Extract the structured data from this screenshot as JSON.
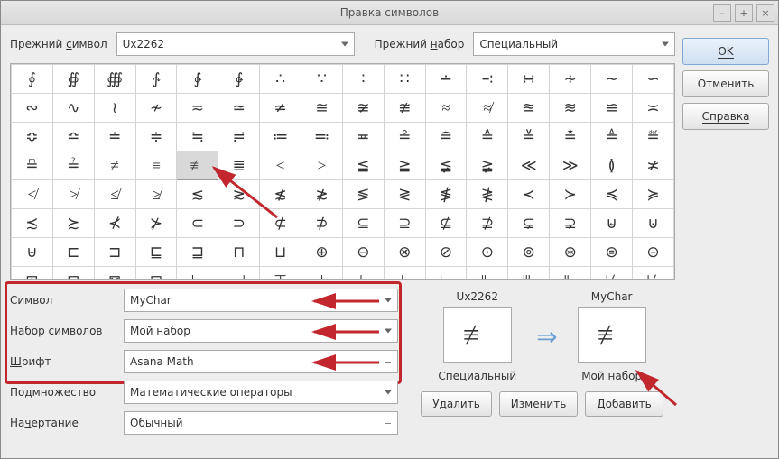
{
  "title": "Правка символов",
  "window_buttons": {
    "min": "–",
    "max": "+",
    "close": "×"
  },
  "side_buttons": {
    "ok": "OK",
    "cancel": "Отменить",
    "help": "Справка"
  },
  "top": {
    "old_symbol_label_pre": "Прежний ",
    "old_symbol_label_u": "с",
    "old_symbol_label_post": "имвол",
    "old_symbol_value": "Ux2262",
    "old_set_label_pre": "Прежний ",
    "old_set_label_u": "н",
    "old_set_label_post": "абор",
    "old_set_value": "Специальный"
  },
  "selected_char": "≢",
  "form": {
    "symbol_label": "Символ",
    "symbol_value": "MyChar",
    "set_label": "Набор символов",
    "set_value": "Мой набор",
    "font_label_u": "Ш",
    "font_label_post": "рифт",
    "font_value": "Asana Math",
    "subset_label": "Подмножество",
    "subset_value": "Математические операторы",
    "style_label_pre": "На",
    "style_label_u": "ч",
    "style_label_post": "ертание",
    "style_value": "Обычный"
  },
  "preview": {
    "old_name": "Ux2262",
    "old_char": "≢",
    "old_set": "Специальный",
    "new_name": "MyChar",
    "new_char": "≢",
    "new_set": "Мой набор",
    "arrow": "⇒"
  },
  "action_buttons": {
    "delete": "Удалить",
    "change": "Изменить",
    "add": "Добавить"
  },
  "grid": [
    [
      "∮",
      "∯",
      "∰",
      "∱",
      "∲",
      "∳",
      "∴",
      "∵",
      "∶",
      "∷",
      "∸",
      "∹",
      "∺",
      "∻",
      "∼",
      "∽"
    ],
    [
      "∾",
      "∿",
      "≀",
      "≁",
      "≂",
      "≃",
      "≄",
      "≅",
      "≆",
      "≇",
      "≈",
      "≉",
      "≊",
      "≋",
      "≌",
      "≍"
    ],
    [
      "≎",
      "≏",
      "≐",
      "≑",
      "≒",
      "≓",
      "≔",
      "≕",
      "≖",
      "≗",
      "≘",
      "≙",
      "≚",
      "≛",
      "≜",
      "≝"
    ],
    [
      "≞",
      "≟",
      "≠",
      "≡",
      "≢",
      "≣",
      "≤",
      "≥",
      "≦",
      "≧",
      "≨",
      "≩",
      "≪",
      "≫",
      "≬",
      "≭"
    ],
    [
      "≮",
      "≯",
      "≰",
      "≱",
      "≲",
      "≳",
      "≴",
      "≵",
      "≶",
      "≷",
      "≸",
      "≹",
      "≺",
      "≻",
      "≼",
      "≽"
    ],
    [
      "≾",
      "≿",
      "⊀",
      "⊁",
      "⊂",
      "⊃",
      "⊄",
      "⊅",
      "⊆",
      "⊇",
      "⊈",
      "⊉",
      "⊊",
      "⊋",
      "⊌",
      "⊍"
    ],
    [
      "⊎",
      "⊏",
      "⊐",
      "⊑",
      "⊒",
      "⊓",
      "⊔",
      "⊕",
      "⊖",
      "⊗",
      "⊘",
      "⊙",
      "⊚",
      "⊛",
      "⊜",
      "⊝"
    ],
    [
      "⊞",
      "⊟",
      "⊠",
      "⊡",
      "⊢",
      "⊣",
      "⊤",
      "⊥",
      "⊦",
      "⊧",
      "⊨",
      "⊩",
      "⊪",
      "⊫",
      "⊬",
      "⊭"
    ]
  ],
  "selected_cell": {
    "row": 3,
    "col": 4
  }
}
